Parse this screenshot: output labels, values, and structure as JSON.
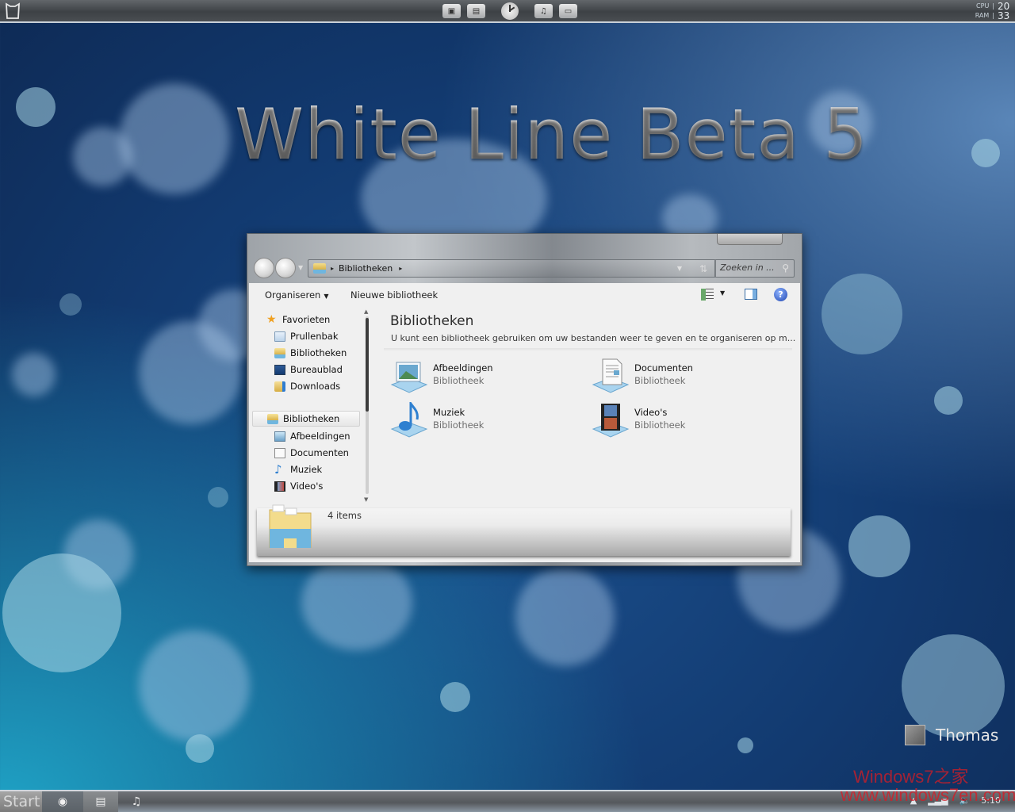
{
  "desktop": {
    "wallpaper_title": "White Line Beta 5",
    "user_name": "Thomas",
    "watermark_line1": "Windows7之家",
    "watermark_line2": "www.windows7en.com"
  },
  "topbar": {
    "dock_items": [
      {
        "name": "pictures-folder",
        "glyph": "▣"
      },
      {
        "name": "documents-folder",
        "glyph": "▤"
      },
      {
        "name": "clock",
        "glyph": ""
      },
      {
        "name": "music-folder",
        "glyph": "♫"
      },
      {
        "name": "videos-folder",
        "glyph": "▭"
      }
    ],
    "stats": {
      "cpu_label": "CPU",
      "cpu_value": "20",
      "ram_label": "RAM",
      "ram_value": "33",
      "separator": "|"
    }
  },
  "explorer": {
    "address": {
      "segments": [
        "Bibliotheken"
      ],
      "arrow": "▸"
    },
    "search_placeholder": "Zoeken in ...",
    "toolbar": {
      "organize_label": "Organiseren",
      "new_library_label": "Nieuwe bibliotheek",
      "help_glyph": "?"
    },
    "sidebar": {
      "favorites": {
        "label": "Favorieten",
        "items": [
          {
            "label": "Prullenbak",
            "icon": "recycle-bin"
          },
          {
            "label": "Bibliotheken",
            "icon": "libraries"
          },
          {
            "label": "Bureaublad",
            "icon": "desktop"
          },
          {
            "label": "Downloads",
            "icon": "downloads"
          }
        ]
      },
      "libraries": {
        "label": "Bibliotheken",
        "items": [
          {
            "label": "Afbeeldingen",
            "icon": "pictures"
          },
          {
            "label": "Documenten",
            "icon": "documents"
          },
          {
            "label": "Muziek",
            "icon": "music"
          },
          {
            "label": "Video's",
            "icon": "videos"
          }
        ]
      }
    },
    "content": {
      "title": "Bibliotheken",
      "description": "U kunt een bibliotheek gebruiken om uw bestanden weer te geven en te organiseren op m...",
      "libraries": [
        {
          "name": "Afbeeldingen",
          "type": "Bibliotheek",
          "icon": "pictures"
        },
        {
          "name": "Documenten",
          "type": "Bibliotheek",
          "icon": "documents"
        },
        {
          "name": "Muziek",
          "type": "Bibliotheek",
          "icon": "music"
        },
        {
          "name": "Video's",
          "type": "Bibliotheek",
          "icon": "videos"
        }
      ]
    },
    "details": {
      "item_count": "4 items"
    }
  },
  "taskbar": {
    "start_label": "Start",
    "buttons": [
      {
        "name": "firefox",
        "glyph": "◉"
      },
      {
        "name": "explorer",
        "glyph": "▤"
      },
      {
        "name": "music",
        "glyph": "♫"
      }
    ],
    "tray": {
      "clock": "5:10"
    }
  }
}
